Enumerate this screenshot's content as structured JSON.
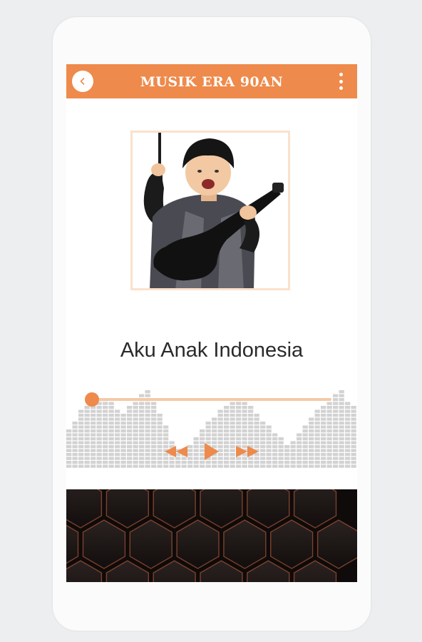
{
  "appbar": {
    "title": "MUSIK ERA 90AN"
  },
  "player": {
    "song_title": "Aku Anak Indonesia",
    "progress": 0.0
  },
  "colors": {
    "accent": "#ee8a4b",
    "accent_light": "#f5c9a6",
    "bar_gray": "#d2d2d2"
  },
  "icons": {
    "back": "chevron-left-icon",
    "menu": "more-vertical-icon",
    "rewind": "rewind-icon",
    "play": "play-icon",
    "forward": "fast-forward-icon"
  }
}
